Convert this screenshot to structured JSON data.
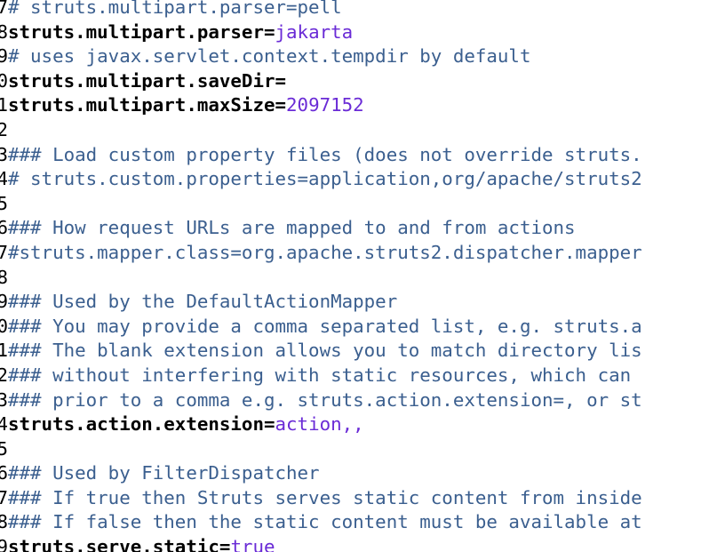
{
  "colors": {
    "comment": "#3b5f8f",
    "key": "#000000",
    "value": "#6a2bd6",
    "background": "#ffffff"
  },
  "lines": [
    {
      "n": "7",
      "type": "comment",
      "text": "# struts.multipart.parser=pell"
    },
    {
      "n": "8",
      "type": "prop",
      "key": "struts.multipart.parser",
      "eq": "=",
      "value": "jakarta"
    },
    {
      "n": "9",
      "type": "comment",
      "text": "# uses javax.servlet.context.tempdir by default"
    },
    {
      "n": "0",
      "type": "prop",
      "key": "struts.multipart.saveDir",
      "eq": "=",
      "value": ""
    },
    {
      "n": "1",
      "type": "prop",
      "key": "struts.multipart.maxSize",
      "eq": "=",
      "value": "2097152"
    },
    {
      "n": "2",
      "type": "blank",
      "text": ""
    },
    {
      "n": "3",
      "type": "comment",
      "text": "### Load custom property files (does not override struts."
    },
    {
      "n": "4",
      "type": "comment",
      "text": "# struts.custom.properties=application,org/apache/struts2"
    },
    {
      "n": "5",
      "type": "blank",
      "text": ""
    },
    {
      "n": "6",
      "type": "comment",
      "text": "### How request URLs are mapped to and from actions"
    },
    {
      "n": "7",
      "type": "comment",
      "text": "#struts.mapper.class=org.apache.struts2.dispatcher.mapper"
    },
    {
      "n": "8",
      "type": "blank",
      "text": ""
    },
    {
      "n": "9",
      "type": "comment",
      "text": "### Used by the DefaultActionMapper"
    },
    {
      "n": "0",
      "type": "comment",
      "text": "### You may provide a comma separated list, e.g. struts.a"
    },
    {
      "n": "1",
      "type": "comment",
      "text": "### The blank extension allows you to match directory lis"
    },
    {
      "n": "2",
      "type": "comment",
      "text": "### without interfering with static resources, which can "
    },
    {
      "n": "3",
      "type": "comment",
      "text": "### prior to a comma e.g. struts.action.extension=, or st"
    },
    {
      "n": "4",
      "type": "prop",
      "key": "struts.action.extension",
      "eq": "=",
      "value": "action,,"
    },
    {
      "n": "5",
      "type": "blank",
      "text": ""
    },
    {
      "n": "6",
      "type": "comment",
      "text": "### Used by FilterDispatcher"
    },
    {
      "n": "7",
      "type": "comment",
      "text": "### If true then Struts serves static content from inside"
    },
    {
      "n": "8",
      "type": "comment",
      "text": "### If false then the static content must be available at"
    },
    {
      "n": "9",
      "type": "prop",
      "key": "struts.serve.static",
      "eq": "=",
      "value": "true"
    }
  ]
}
